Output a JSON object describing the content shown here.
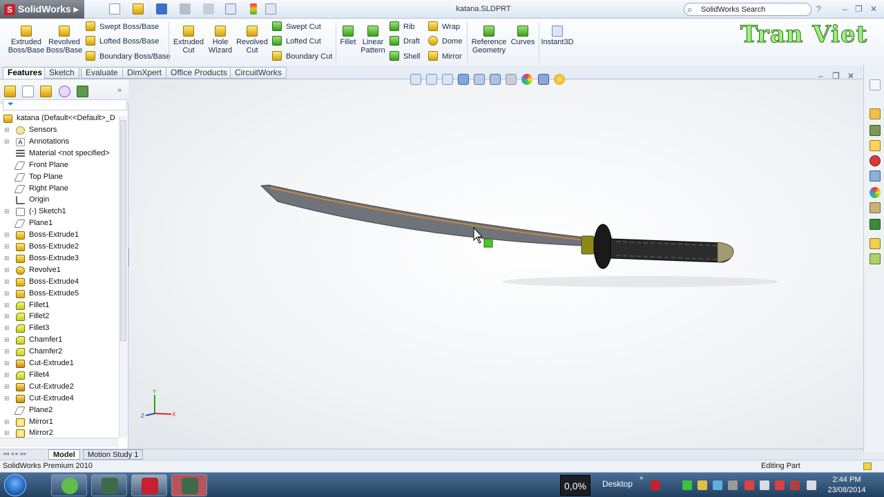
{
  "app": {
    "name": "SolidWorks",
    "doc_title": "katana.SLDPRT",
    "search_placeholder": "SolidWorks Search",
    "brand_overlay": "Tran Viet"
  },
  "ribbon": {
    "extruded_boss": "Extruded Boss/Base",
    "revolved_boss": "Revolved Boss/Base",
    "swept_boss": "Swept Boss/Base",
    "lofted_boss": "Lofted Boss/Base",
    "boundary_boss": "Boundary Boss/Base",
    "extruded_cut": "Extruded Cut",
    "hole_wizard": "Hole Wizard",
    "revolved_cut": "Revolved Cut",
    "swept_cut": "Swept Cut",
    "lofted_cut": "Lofted Cut",
    "boundary_cut": "Boundary Cut",
    "fillet": "Fillet",
    "linear_pattern": "Linear Pattern",
    "rib": "Rib",
    "draft": "Draft",
    "shell": "Shell",
    "wrap": "Wrap",
    "dome": "Dome",
    "mirror": "Mirror",
    "reference_geometry": "Reference Geometry",
    "curves": "Curves",
    "instant3d": "Instant3D"
  },
  "tabs": [
    "Features",
    "Sketch",
    "Evaluate",
    "DimXpert",
    "Office Products",
    "CircuitWorks"
  ],
  "tree": {
    "root": "katana  (Default<<Default>_D",
    "items": [
      {
        "label": "Sensors",
        "icon": "sensor"
      },
      {
        "label": "Annotations",
        "icon": "ann"
      },
      {
        "label": "Material <not specified>",
        "icon": "mat"
      },
      {
        "label": "Front Plane",
        "icon": "plane"
      },
      {
        "label": "Top Plane",
        "icon": "plane"
      },
      {
        "label": "Right Plane",
        "icon": "plane"
      },
      {
        "label": "Origin",
        "icon": "origin"
      },
      {
        "label": "(-) Sketch1",
        "icon": "sketch"
      },
      {
        "label": "Plane1",
        "icon": "plane"
      },
      {
        "label": "Boss-Extrude1",
        "icon": "boss"
      },
      {
        "label": "Boss-Extrude2",
        "icon": "boss"
      },
      {
        "label": "Boss-Extrude3",
        "icon": "boss"
      },
      {
        "label": "Revolve1",
        "icon": "rev"
      },
      {
        "label": "Boss-Extrude4",
        "icon": "boss"
      },
      {
        "label": "Boss-Extrude5",
        "icon": "boss"
      },
      {
        "label": "Fillet1",
        "icon": "fillet"
      },
      {
        "label": "Fillet2",
        "icon": "fillet"
      },
      {
        "label": "Fillet3",
        "icon": "fillet"
      },
      {
        "label": "Chamfer1",
        "icon": "fillet"
      },
      {
        "label": "Chamfer2",
        "icon": "fillet"
      },
      {
        "label": "Cut-Extrude1",
        "icon": "cut"
      },
      {
        "label": "Fillet4",
        "icon": "fillet"
      },
      {
        "label": "Cut-Extrude2",
        "icon": "cut"
      },
      {
        "label": "Cut-Extrude4",
        "icon": "cut"
      },
      {
        "label": "Plane2",
        "icon": "plane"
      },
      {
        "label": "Mirror1",
        "icon": "mirror"
      },
      {
        "label": "Mirror2",
        "icon": "mirror"
      }
    ]
  },
  "bottom_tabs": [
    "Model",
    "Motion Study 1"
  ],
  "status": {
    "left": "SolidWorks Premium 2010",
    "right": "Editing Part"
  },
  "taskbar": {
    "cpu": "0,0%",
    "desktop": "Desktop",
    "time": "2:44 PM",
    "date": "23/08/2014"
  },
  "triad": {
    "y": "Y",
    "x": "X",
    "z": "Z"
  },
  "colors": {
    "ribbon_yellow": "#e8b82a",
    "brand_green": "#9ef07a",
    "taskbar": "#2d4f74"
  }
}
